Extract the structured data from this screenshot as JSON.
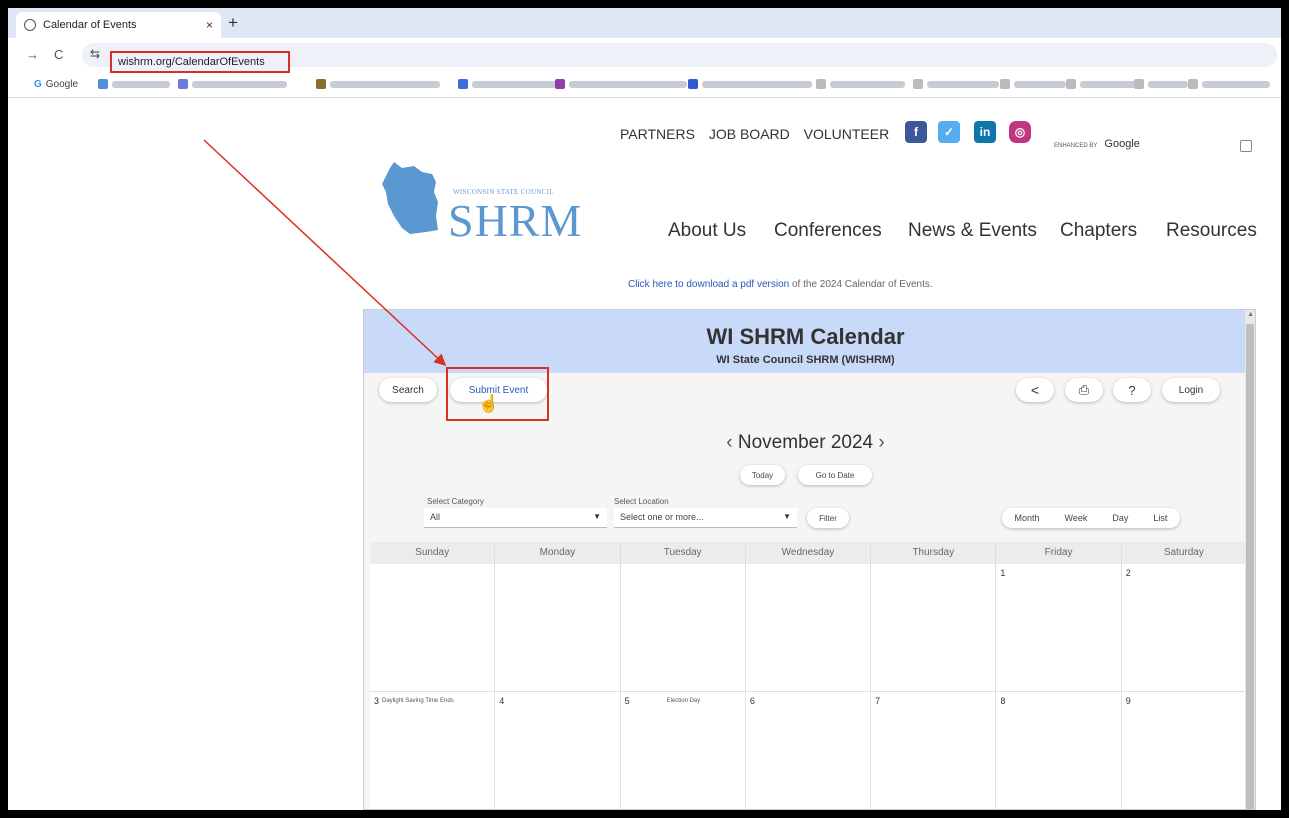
{
  "browser": {
    "tab_title": "Calendar of Events",
    "tab_close": "×",
    "new_tab": "+",
    "url": "wishrm.org/CalendarOfEvents",
    "bookmarks": {
      "google": "Google",
      "g_letter": "G"
    }
  },
  "site": {
    "top_links": [
      "PARTNERS",
      "JOB BOARD",
      "VOLUNTEER"
    ],
    "search_enhanced": "ENHANCED BY",
    "search_google": "Google",
    "logo_small": "WISCONSIN STATE COUNCIL",
    "logo_big": "SHRM",
    "nav": [
      "About Us",
      "Conferences",
      "News & Events",
      "Chapters",
      "Resources"
    ],
    "pdf_link": "Click here to download a pdf version",
    "pdf_rest": " of the 2024 Calendar of Events."
  },
  "calendar": {
    "title": "WI SHRM Calendar",
    "subtitle": "WI State Council SHRM (WISHRM)",
    "search_label": "Search",
    "submit_label": "Submit Event",
    "login_label": "Login",
    "month_label": "November 2024",
    "prev": "‹",
    "next": "›",
    "today_label": "Today",
    "goto_label": "Go to Date",
    "category_label": "Select Category",
    "category_value": "All",
    "location_label": "Select Location",
    "location_placeholder": "Select one or more...",
    "filter_label": "Filter",
    "views": [
      "Month",
      "Week",
      "Day",
      "List"
    ],
    "days_of_week": [
      "Sunday",
      "Monday",
      "Tuesday",
      "Wednesday",
      "Thursday",
      "Friday",
      "Saturday"
    ],
    "week1": [
      "",
      "",
      "",
      "",
      "",
      "1",
      "2"
    ],
    "week2": [
      "3",
      "4",
      "5",
      "6",
      "7",
      "8",
      "9"
    ],
    "events": {
      "dst": "Daylight Saving Time Ends",
      "election": "Election Day"
    }
  },
  "colors": {
    "accent": "#2a59b8",
    "header_bg": "#c9daf8",
    "annotation": "#d93025",
    "logo": "#5b97d1"
  }
}
